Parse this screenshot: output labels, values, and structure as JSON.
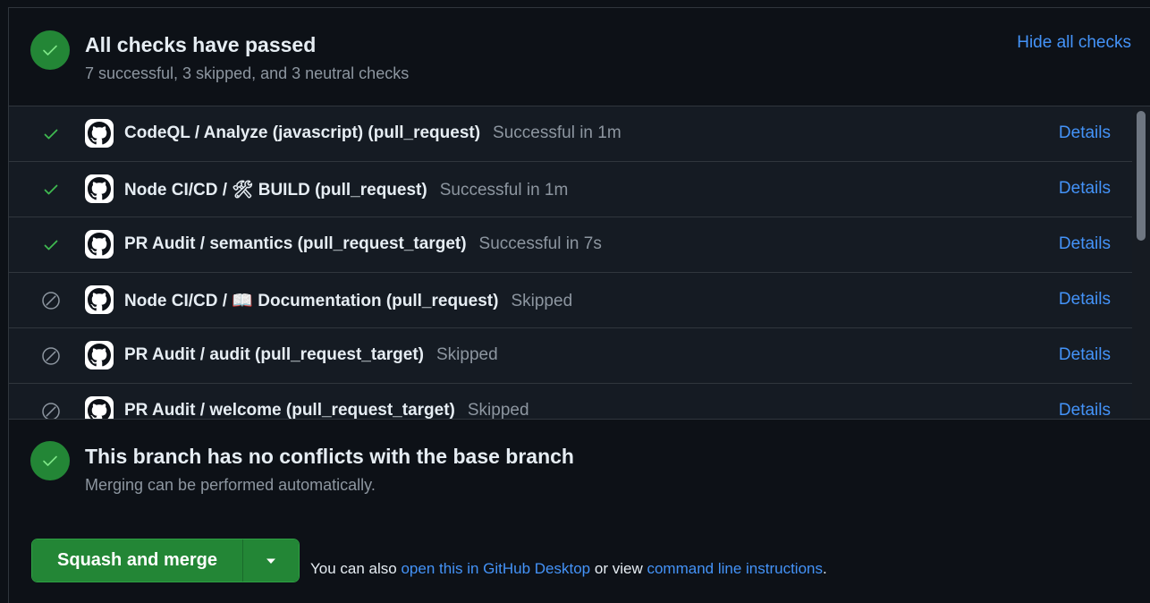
{
  "checks_summary": {
    "title": "All checks have passed",
    "subtitle": "7 successful, 3 skipped, and 3 neutral checks",
    "hide_label": "Hide all checks",
    "status_color": "#238636"
  },
  "checks": [
    {
      "state": "success",
      "name": "CodeQL / Analyze (javascript) (pull_request)",
      "status": "Successful in 1m",
      "details": "Details"
    },
    {
      "state": "success",
      "name": "Node CI/CD / 🛠 BUILD (pull_request)",
      "status": "Successful in 1m",
      "details": "Details"
    },
    {
      "state": "success",
      "name": "PR Audit / semantics (pull_request_target)",
      "status": "Successful in 7s",
      "details": "Details"
    },
    {
      "state": "skipped",
      "name": "Node CI/CD / 📖 Documentation (pull_request)",
      "status": "Skipped",
      "details": "Details"
    },
    {
      "state": "skipped",
      "name": "PR Audit / audit (pull_request_target)",
      "status": "Skipped",
      "details": "Details"
    },
    {
      "state": "skipped",
      "name": "PR Audit / welcome (pull_request_target)",
      "status": "Skipped",
      "details": "Details"
    }
  ],
  "merge_state": {
    "title": "This branch has no conflicts with the base branch",
    "subtitle": "Merging can be performed automatically."
  },
  "actions": {
    "merge_label": "Squash and merge",
    "hint_prefix": "You can also",
    "desktop_link": "open this in GitHub Desktop",
    "hint_middle": "or view",
    "cli_link": "command line instructions",
    "hint_suffix": "."
  },
  "colors": {
    "success": "#3fb950",
    "skipped": "#8d96a0",
    "link": "#4493f8",
    "button": "#238636"
  },
  "icons": {
    "success": "check-icon",
    "skipped": "skip-icon",
    "avatar": "github-logo-icon"
  }
}
